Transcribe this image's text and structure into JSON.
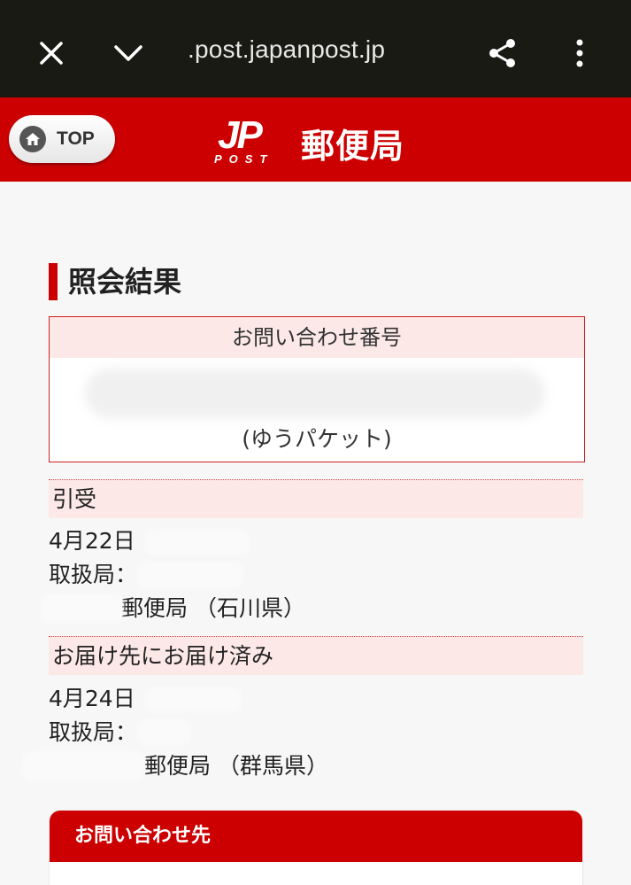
{
  "browser": {
    "url": ".post.japanpost.jp",
    "icons": [
      "close-icon",
      "chevron-down-icon",
      "share-icon",
      "more-vert-icon"
    ]
  },
  "header": {
    "top_button_label": "TOP",
    "logo_jp": "JP",
    "logo_post": "POST",
    "site_name": "郵便局",
    "color": "#cc0000"
  },
  "result": {
    "section_title": "照会結果",
    "inquiry_label": "お問い合わせ番号",
    "item_type": "(ゆうパケット)"
  },
  "events": [
    {
      "status": "引受",
      "date": "4月22日",
      "office_label": "取扱局：",
      "office": "郵便局 （石川県）"
    },
    {
      "status": "お届け先にお届け済み",
      "date": "4月24日",
      "office_label": "取扱局：",
      "office": "郵便局 （群馬県）"
    }
  ],
  "contact": {
    "title": "お問い合わせ先"
  }
}
